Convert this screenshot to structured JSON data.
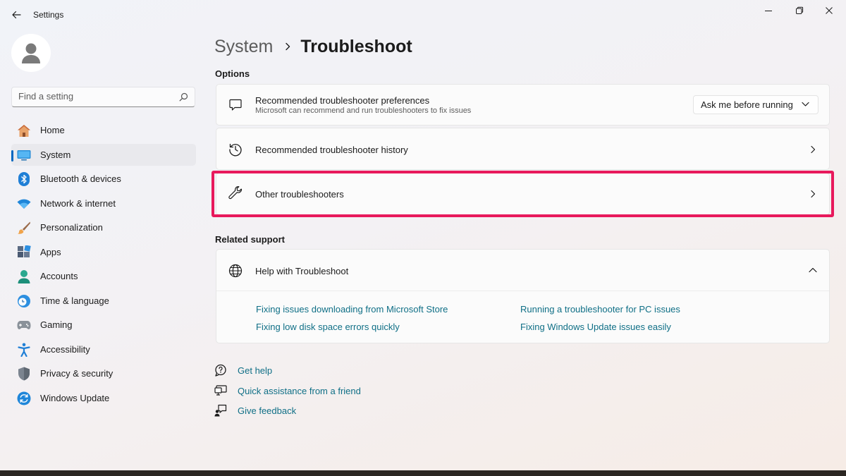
{
  "window": {
    "title": "Settings",
    "controls": [
      "minimize",
      "maximize",
      "close"
    ]
  },
  "sidebar": {
    "search_placeholder": "Find a setting",
    "items": [
      {
        "label": "Home",
        "icon": "home-icon",
        "active": false
      },
      {
        "label": "System",
        "icon": "system-icon",
        "active": true
      },
      {
        "label": "Bluetooth & devices",
        "icon": "bluetooth-icon",
        "active": false
      },
      {
        "label": "Network & internet",
        "icon": "wifi-icon",
        "active": false
      },
      {
        "label": "Personalization",
        "icon": "brush-icon",
        "active": false
      },
      {
        "label": "Apps",
        "icon": "apps-icon",
        "active": false
      },
      {
        "label": "Accounts",
        "icon": "accounts-icon",
        "active": false
      },
      {
        "label": "Time & language",
        "icon": "clock-globe-icon",
        "active": false
      },
      {
        "label": "Gaming",
        "icon": "gamepad-icon",
        "active": false
      },
      {
        "label": "Accessibility",
        "icon": "accessibility-icon",
        "active": false
      },
      {
        "label": "Privacy & security",
        "icon": "shield-icon",
        "active": false
      },
      {
        "label": "Windows Update",
        "icon": "update-icon",
        "active": false
      }
    ]
  },
  "breadcrumb": {
    "parent": "System",
    "current": "Troubleshoot"
  },
  "options": {
    "heading": "Options",
    "preferences": {
      "title": "Recommended troubleshooter preferences",
      "subtitle": "Microsoft can recommend and run troubleshooters to fix issues",
      "dropdown_value": "Ask me before running"
    },
    "history": {
      "title": "Recommended troubleshooter history"
    },
    "other": {
      "title": "Other troubleshooters",
      "highlighted": true
    }
  },
  "related": {
    "heading": "Related support",
    "expander_title": "Help with Troubleshoot",
    "links": [
      "Fixing issues downloading from Microsoft Store",
      "Running a troubleshooter for PC issues",
      "Fixing low disk space errors quickly",
      "Fixing Windows Update issues easily"
    ]
  },
  "help": {
    "get_help": "Get help",
    "quick_assist": "Quick assistance from a friend",
    "feedback": "Give feedback"
  },
  "colors": {
    "accent": "#0067c0",
    "link": "#0f6f86",
    "highlight_border": "#e8195c"
  }
}
